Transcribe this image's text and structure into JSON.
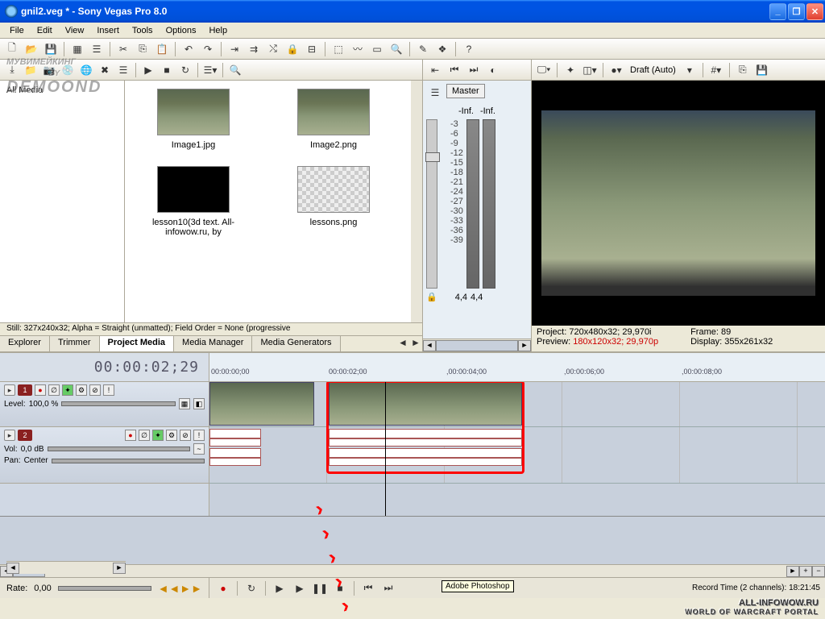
{
  "window": {
    "title": "gnil2.veg * - Sony Vegas Pro 8.0"
  },
  "menu": [
    "File",
    "Edit",
    "View",
    "Insert",
    "Tools",
    "Options",
    "Help"
  ],
  "media": {
    "tree_root": "All Media",
    "items": [
      {
        "label": "Image1.jpg",
        "kind": "game"
      },
      {
        "label": "Image2.png",
        "kind": "game"
      },
      {
        "label": "lesson10(3d text. All-infowow.ru, by",
        "kind": "black"
      },
      {
        "label": "lessons.png",
        "kind": "checker"
      }
    ],
    "status": "Still: 327x240x32; Alpha = Straight (unmatted); Field Order = None (progressive"
  },
  "tabs": [
    "Explorer",
    "Trimmer",
    "Project Media",
    "Media Manager",
    "Media Generators"
  ],
  "active_tab": "Project Media",
  "mixer": {
    "label": "Master",
    "peak_left": "-Inf.",
    "peak_right": "-Inf.",
    "scale": [
      "-3",
      "-6",
      "-9",
      "-12",
      "-15",
      "-18",
      "-21",
      "-24",
      "-27",
      "-30",
      "-33",
      "-36",
      "-39"
    ],
    "fader_left": "4,4",
    "fader_right": "4,4"
  },
  "preview": {
    "quality": "Draft (Auto)",
    "info": {
      "project_label": "Project:",
      "project_val": "720x480x32; 29,970i",
      "preview_label": "Preview:",
      "preview_val": "180x120x32; 29,970p",
      "frame_label": "Frame:",
      "frame_val": "89",
      "display_label": "Display:",
      "display_val": "355x261x32"
    }
  },
  "timeline": {
    "timecode": "00:00:02;29",
    "ruler": [
      "00:00:00;00",
      "00:00:02;00",
      ",00:00:04;00",
      ",00:00:06;00",
      ",00:00:08;00"
    ],
    "tracks": [
      {
        "num": "1",
        "type": "video",
        "level_label": "Level:",
        "level_val": "100,0 %"
      },
      {
        "num": "2",
        "type": "audio",
        "vol_label": "Vol:",
        "vol_val": "0,0 dB",
        "pan_label": "Pan:",
        "pan_val": "Center"
      }
    ],
    "rate_label": "Rate:",
    "rate_val": "0,00"
  },
  "tooltip": "Adobe Photoshop",
  "record_time": "Record Time (2 channels): 18:21:45",
  "watermark": {
    "line1": "МУВИМЕЙКИНГ",
    "by": "BY",
    "author": "DEMOOND"
  },
  "brand": {
    "main": "ALL-INFOWOW.RU",
    "sub": "WORLD OF WARCRAFT PORTAL"
  }
}
